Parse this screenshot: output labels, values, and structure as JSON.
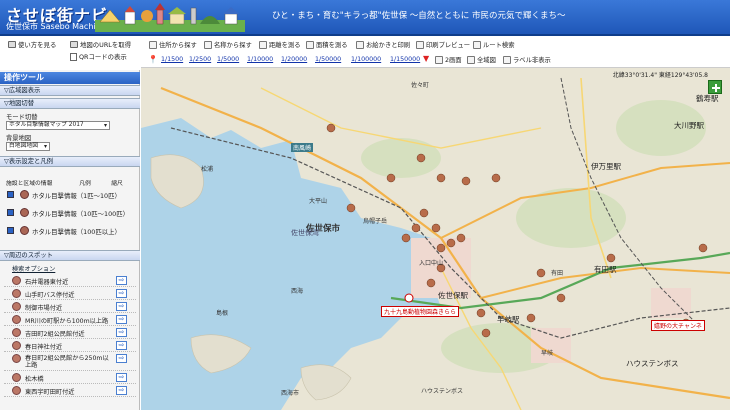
{
  "header": {
    "title": "させぼ街ナビ",
    "subtitle": "佐世保市 Sasebo Machi Navi",
    "slogan": "ひと・まち・育む\"キラっ都\"佐世保 〜自然とともに 市民の元気で輝くまち〜"
  },
  "top_links": {
    "favorite": "使い方を見る",
    "url_get": "地図のURLを取得",
    "qr_show": "QRコードの表示"
  },
  "tools": {
    "title": "操作ツール",
    "wide_map": "▽広域図表示",
    "map_switch": "▽地図切替",
    "mode_label": "モード切替",
    "mode_value": "ホタル目撃情報マップ 2017",
    "bg_label": "背景地図",
    "bg_value": "白地図地図",
    "legend_section": "▽表示設定と凡例",
    "legend_head": {
      "col1": "施設と区域の情報",
      "col2": "凡例",
      "col3": "縮尺"
    },
    "legend_items": [
      {
        "label": "ホタル目撃情報（1匹〜10匹）"
      },
      {
        "label": "ホタル目撃情報（10匹〜100匹）"
      },
      {
        "label": "ホタル目撃情報（100匹以上）"
      }
    ],
    "spot_section": "▽周辺のスポット",
    "spot_option": "検索オプション",
    "spots": [
      {
        "label": "石井電器東付近"
      },
      {
        "label": "山手町バス停付近"
      },
      {
        "label": "制御市場付近"
      },
      {
        "label": "MR川の町駅から100m以上路"
      },
      {
        "label": "吉田町2組公民館付近"
      },
      {
        "label": "春日神社付近"
      },
      {
        "label": "春日町2組公民館から250m以上路"
      },
      {
        "label": "松木橋"
      },
      {
        "label": "東西宇町田町付近"
      }
    ]
  },
  "mapbar": {
    "buttons": [
      "住所から探す",
      "名称から探す",
      "距離を測る",
      "面積を測る",
      "お絵かきと印刷",
      "印刷プレビュー",
      "ルート検索"
    ],
    "scales": [
      "1/1500",
      "1/2500",
      "1/5000",
      "1/10000",
      "1/20000",
      "1/50000",
      "1/100000",
      "1/150000"
    ],
    "view_2": "2画面",
    "view_all": "全域図",
    "view_label": "ラベル非表示"
  },
  "map": {
    "coord": "北緯33°0'31.4\" 東経129°43'05.8",
    "city": "佐世保市",
    "stations": [
      "佐世保駅",
      "伊万里駅",
      "大川野駅",
      "有田駅",
      "早岐駅",
      "鶴寿駅",
      "ハウステンボス"
    ],
    "labels": [
      "佐々町",
      "松浦",
      "西海",
      "島根",
      "入口中山",
      "佐世保",
      "有田",
      "早岐",
      "ハウステンボス",
      "西海市"
    ],
    "hospital": "九十九島動植物園森きらら",
    "hospital2": "嬉野の大チャンネ",
    "mountain": "大平山",
    "mountain2": "烏帽子岳",
    "port": "南風崎",
    "bay": "佐世保湾"
  }
}
